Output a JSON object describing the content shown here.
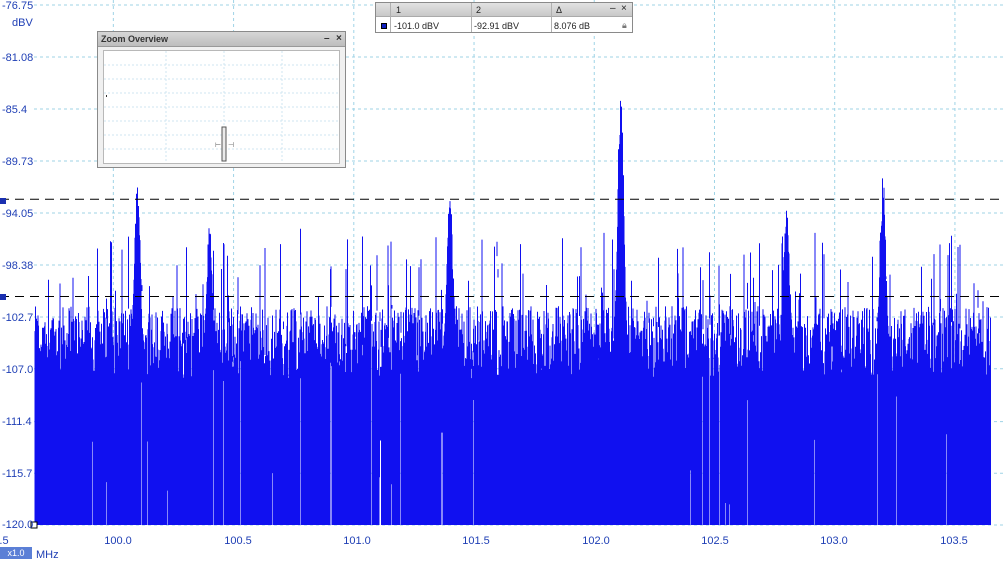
{
  "y_axis": {
    "unit": "dBV",
    "ticks": [
      "-76.75",
      "-81.08",
      "-85.4",
      "-89.73",
      "-94.05",
      "-98.38",
      "-102.7",
      "-107.0",
      "-111.4",
      "-115.7",
      "-120.0"
    ]
  },
  "x_axis": {
    "unit": "MHz",
    "start_label": ".5",
    "ticks": [
      "100.0",
      "100.5",
      "101.0",
      "101.5",
      "102.0",
      "102.5",
      "103.0",
      "103.5"
    ]
  },
  "zoom_badge": "x1.0",
  "zoom_overview": {
    "title": "Zoom Overview",
    "minimize": "–",
    "close": "×"
  },
  "ruler_table": {
    "col1_header": "1",
    "col2_header": "2",
    "delta_header": "Δ",
    "ruler1_value": "-101.0 dBV",
    "ruler2_value": "-92.91 dBV",
    "delta_value": "8.076 dB",
    "minimize": "–",
    "close": "×"
  },
  "colors": {
    "trace": "#1010f0",
    "axis_text": "#1f3fb5",
    "grid": "#9fd3e6",
    "ruler_line": "#000000"
  },
  "chart_data": {
    "type": "line",
    "title": "",
    "xlabel": "MHz",
    "ylabel": "dBV",
    "xlim": [
      99.67,
      103.65
    ],
    "ylim": [
      -120.0,
      -76.75
    ],
    "rulers_dBV": [
      -92.91,
      -101.0
    ],
    "noise_floor_dBV": -106,
    "peaks": [
      {
        "x": 100.1,
        "y": -91.5
      },
      {
        "x": 100.4,
        "y": -95.0
      },
      {
        "x": 101.4,
        "y": -92.3
      },
      {
        "x": 102.11,
        "y": -81.3
      },
      {
        "x": 102.8,
        "y": -93.0
      },
      {
        "x": 103.2,
        "y": -90.5
      }
    ]
  }
}
